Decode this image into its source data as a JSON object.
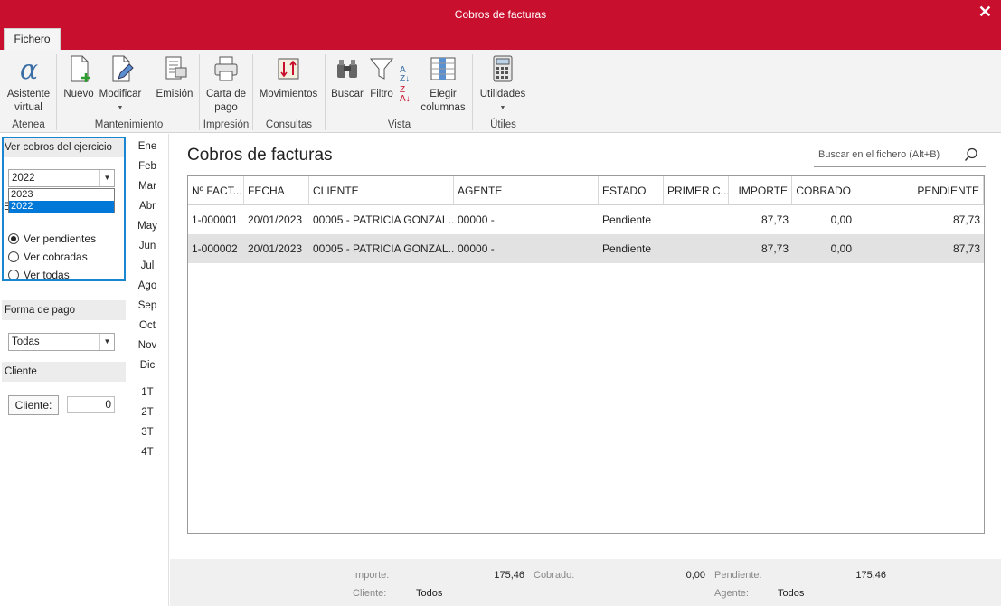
{
  "window": {
    "title": "Cobros de facturas",
    "close": "✕"
  },
  "tabs": {
    "fichero": "Fichero"
  },
  "ribbon": {
    "asistente": "Asistente virtual",
    "nuevo": "Nuevo",
    "modificar": "Modificar",
    "emision": "Emisión",
    "carta": "Carta de pago",
    "movimientos": "Movimientos",
    "buscar": "Buscar",
    "filtro": "Filtro",
    "elegir": "Elegir columnas",
    "utilidades": "Utilidades",
    "groups": {
      "atenea": "Atenea",
      "mantenimiento": "Mantenimiento",
      "impresion": "Impresión",
      "consultas": "Consultas",
      "vista": "Vista",
      "utiles": "Útiles"
    }
  },
  "left": {
    "ejercicio_header": "Ver cobros del ejercicio",
    "ejercicio_selected": "2022",
    "ejercicio_options": [
      "2023",
      "2022"
    ],
    "estado_header_partial": "E",
    "radios": [
      {
        "label": "Ver pendientes",
        "checked": true
      },
      {
        "label": "Ver cobradas",
        "checked": false
      },
      {
        "label": "Ver todas",
        "checked": false
      }
    ],
    "forma_pago_header": "Forma de pago",
    "forma_pago_selected": "Todas",
    "cliente_header": "Cliente",
    "cliente_button": "Cliente:",
    "cliente_value": "0"
  },
  "months": [
    "Ene",
    "Feb",
    "Mar",
    "Abr",
    "May",
    "Jun",
    "Jul",
    "Ago",
    "Sep",
    "Oct",
    "Nov",
    "Dic"
  ],
  "quarters": [
    "1T",
    "2T",
    "3T",
    "4T"
  ],
  "main": {
    "title": "Cobros de facturas",
    "search_placeholder": "Buscar en el fichero (Alt+B)"
  },
  "table": {
    "headers": [
      "Nº FACT...",
      "FECHA",
      "CLIENTE",
      "AGENTE",
      "ESTADO",
      "PRIMER C...",
      "IMPORTE",
      "COBRADO",
      "PENDIENTE"
    ],
    "rows": [
      [
        "1-000001",
        "20/01/2023",
        "00005 - PATRICIA GONZAL...",
        "00000 -",
        "Pendiente",
        "",
        "87,73",
        "0,00",
        "87,73"
      ],
      [
        "1-000002",
        "20/01/2023",
        "00005 - PATRICIA GONZAL...",
        "00000 -",
        "Pendiente",
        "",
        "87,73",
        "0,00",
        "87,73"
      ]
    ]
  },
  "footer": {
    "importe_label": "Importe:",
    "importe_value": "175,46",
    "cobrado_label": "Cobrado:",
    "cobrado_value": "0,00",
    "pendiente_label": "Pendiente:",
    "pendiente_value": "175,46",
    "cliente_label": "Cliente:",
    "cliente_value": "Todos",
    "agente_label": "Agente:",
    "agente_value": "Todos"
  },
  "colors": {
    "brand": "#c8102e",
    "selection": "#0078d7",
    "focus": "#1a86d0"
  }
}
